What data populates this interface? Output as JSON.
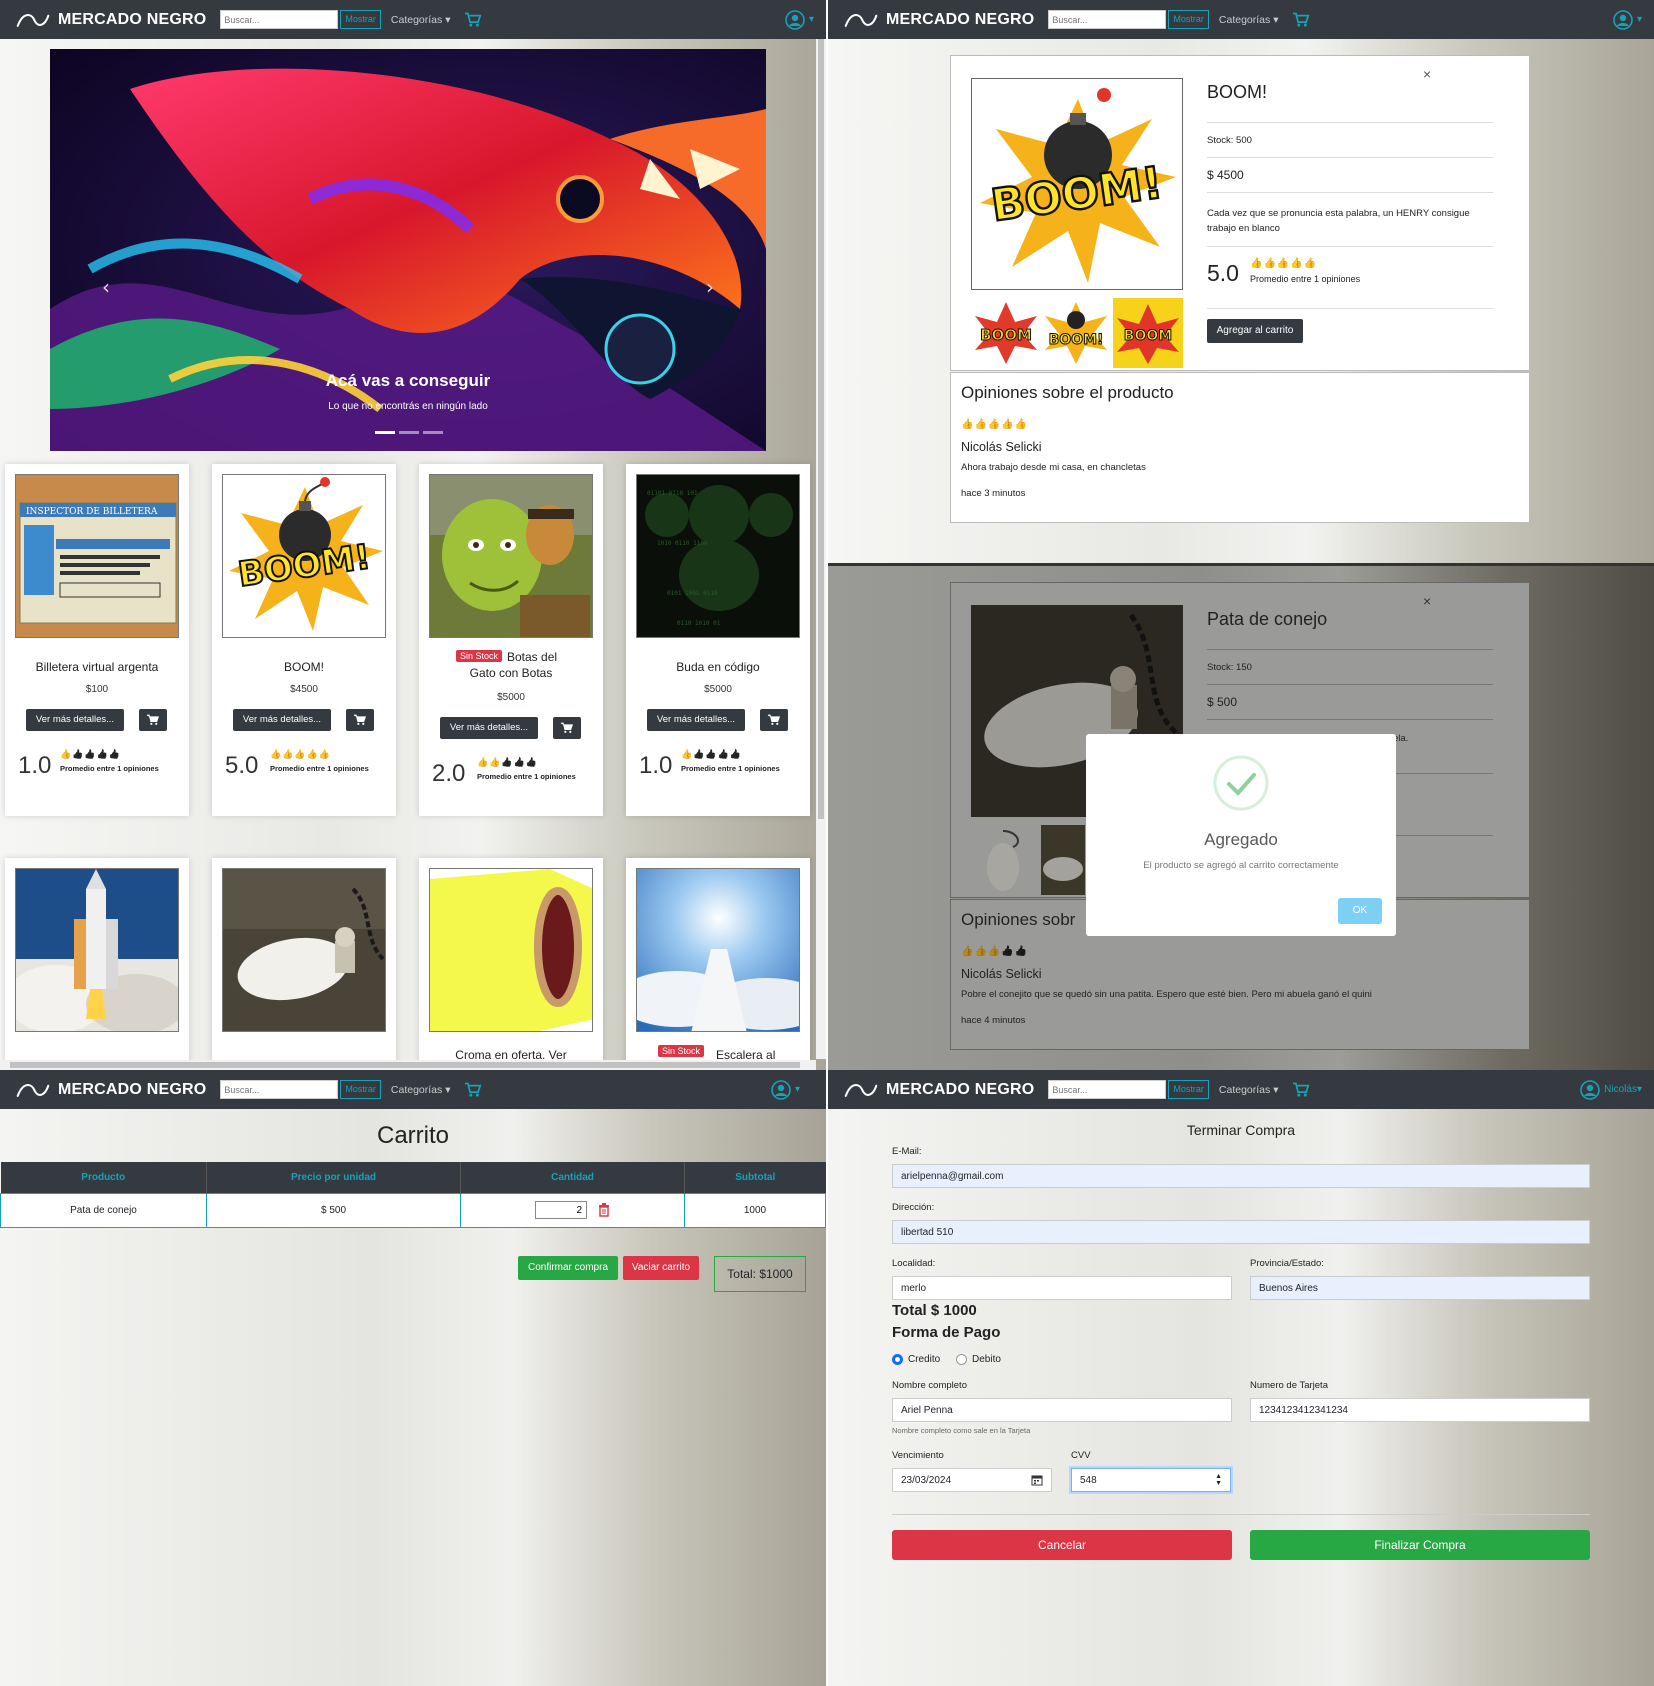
{
  "nav": {
    "brand": "MERCADO NEGRO",
    "search_placeholder": "Buscar...",
    "search_button": "Mostrar",
    "categories_label": "Categorías",
    "user_name": "Nicolás"
  },
  "home": {
    "carousel": {
      "caption_title": "Acá vas a conseguir",
      "caption_text": "Lo que no encontrás en ningún lado",
      "indicator_count": 3,
      "active_indicator": 1
    },
    "products": [
      {
        "name": "Billetera virtual argenta",
        "price": "$100",
        "button": "Ver más detalles...",
        "rating": "1.0",
        "avg": "Promedio entre 1 opiniones",
        "out_of_stock": false
      },
      {
        "name": "BOOM!",
        "price": "$4500",
        "button": "Ver más detalles...",
        "rating": "5.0",
        "avg": "Promedio entre 1 opiniones",
        "out_of_stock": false
      },
      {
        "name": "Botas del Gato con Botas",
        "name_line1": "Botas del",
        "name_line2": "Gato con Botas",
        "price": "$5000",
        "button": "Ver más detalles...",
        "rating": "2.0",
        "avg": "Promedio entre 1 opiniones",
        "out_of_stock": true,
        "badge": "Sin Stock"
      },
      {
        "name": "Buda en código",
        "price": "$5000",
        "button": "Ver más detalles...",
        "rating": "1.0",
        "avg": "Promedio entre 1 opiniones",
        "out_of_stock": false
      }
    ],
    "products_row2": [
      {
        "name": "",
        "image": "rocket-launch"
      },
      {
        "name": "",
        "image": "rabbit-foot"
      },
      {
        "name": "Croma en oferta. Ver",
        "image": "yellow-chroma-roll"
      },
      {
        "name": "Escalera al",
        "image": "stairway-to-heaven",
        "badge": "Sin Stock"
      }
    ]
  },
  "product_detail": {
    "title": "BOOM!",
    "stock": "Stock: 500",
    "price": "$ 4500",
    "description": "Cada vez que se pronuncia esta palabra, un HENRY consigue trabajo en blanco",
    "rating": "5.0",
    "avg": "Promedio entre 1 opiniones",
    "add_button": "Agregar al carrito",
    "close": "×",
    "reviews_title": "Opiniones sobre el producto",
    "review": {
      "author": "Nicolás Selicki",
      "text": "Ahora trabajo desde mi casa, en chancletas",
      "time": "hace 3 minutos"
    }
  },
  "added_modal": {
    "product_title": "Pata de conejo",
    "stock": "Stock: 150",
    "price": "$ 500",
    "desc_fragment": "ela.",
    "reviews_title": "Opiniones sobr",
    "review": {
      "author": "Nicolás Selicki",
      "text": "Pobre el conejito que se quedó sin una patita. Espero que esté bien. Pero mi abuela ganó el quini",
      "time": "hace 4 minutos"
    },
    "alert_title": "Agregado",
    "alert_text": "El producto se agregó al carrito correctamente",
    "alert_button": "OK",
    "close": "×"
  },
  "cart": {
    "title": "Carrito",
    "headers": [
      "Producto",
      "Precio por unidad",
      "Cantidad",
      "Subtotal"
    ],
    "rows": [
      {
        "product": "Pata de conejo",
        "unit_price": "$ 500",
        "quantity": "2",
        "subtotal": "1000"
      }
    ],
    "confirm_button": "Confirmar compra",
    "empty_button": "Vaciar carrito",
    "total": "Total: $1000"
  },
  "checkout": {
    "title": "Terminar Compra",
    "email_label": "E-Mail:",
    "email": "arielpenna@gmail.com",
    "address_label": "Dirección:",
    "address": "libertad 510",
    "city_label": "Localidad:",
    "city": "merlo",
    "province_label": "Provincia/Estado:",
    "province": "Buenos Aires",
    "total": "Total $ 1000",
    "payment_title": "Forma de Pago",
    "payment_options": [
      "Credito",
      "Debito"
    ],
    "payment_selected": "Credito",
    "name_label": "Nombre completo",
    "name": "Ariel Penna",
    "name_help": "Nombre completo como sale en la Tarjeta",
    "card_label": "Numero de Tarjeta",
    "card": "1234123412341234",
    "expiry_label": "Vencimiento",
    "expiry": "23/03/2024",
    "cvv_label": "CVV",
    "cvv": "548",
    "cancel_button": "Cancelar",
    "finish_button": "Finalizar Compra"
  },
  "colors": {
    "navbar": "#343a40",
    "accent": "#17a2b8",
    "danger": "#dc3545",
    "success": "#28a745",
    "star": "#f2b21c"
  }
}
